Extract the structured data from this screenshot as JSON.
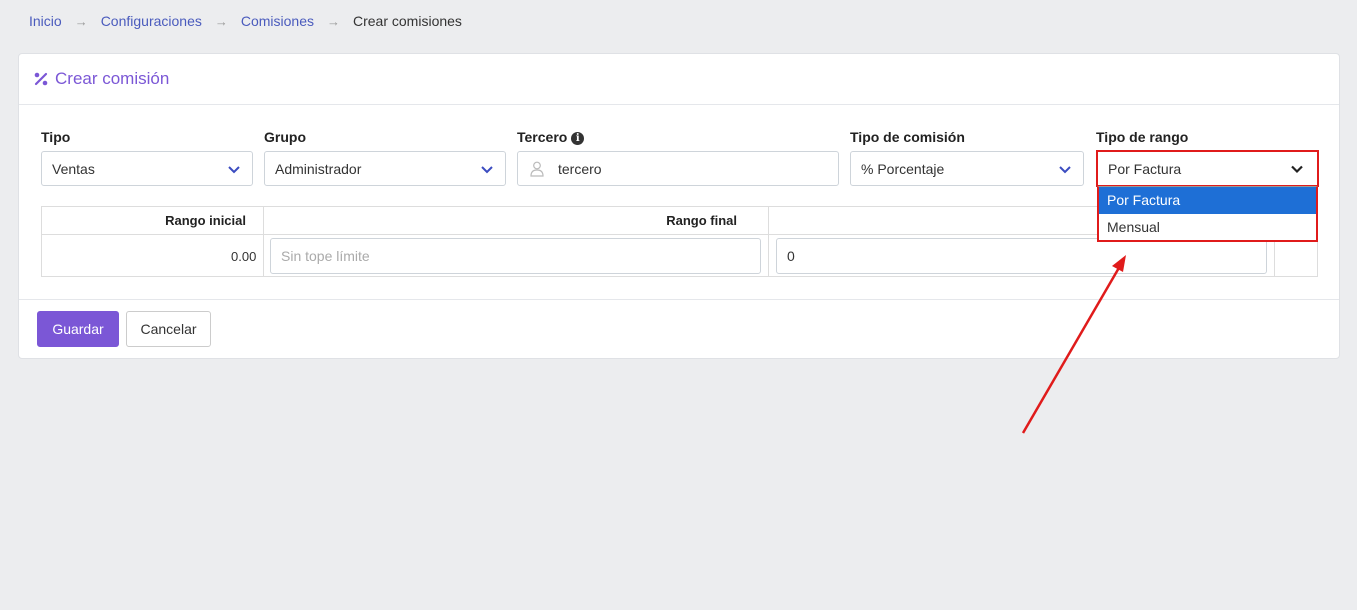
{
  "breadcrumb": {
    "items": [
      "Inicio",
      "Configuraciones",
      "Comisiones"
    ],
    "current": "Crear comisiones",
    "separator": "→"
  },
  "card": {
    "title": "Crear comisión",
    "title_icon": "percent-icon"
  },
  "form": {
    "tipo": {
      "label": "Tipo",
      "value": "Ventas"
    },
    "grupo": {
      "label": "Grupo",
      "value": "Administrador"
    },
    "tercero": {
      "label": "Tercero",
      "value": "tercero",
      "info_icon": "i"
    },
    "tipo_comision": {
      "label": "Tipo de comisión",
      "value": "% Porcentaje"
    },
    "tipo_rango": {
      "label": "Tipo de rango",
      "value": "Por Factura",
      "options": [
        "Por Factura",
        "Mensual"
      ],
      "highlighted": "Por Factura"
    }
  },
  "table": {
    "headers": [
      "Rango inicial",
      "Rango final"
    ],
    "row": {
      "rango_inicial": "0.00",
      "rango_final_placeholder": "Sin tope límite",
      "valor": "0"
    }
  },
  "buttons": {
    "save": "Guardar",
    "cancel": "Cancelar"
  },
  "colors": {
    "accent": "#7b57d6",
    "link": "#4a5bbd",
    "annotation": "#e01b1b",
    "selected_option": "#1e6fd6"
  }
}
